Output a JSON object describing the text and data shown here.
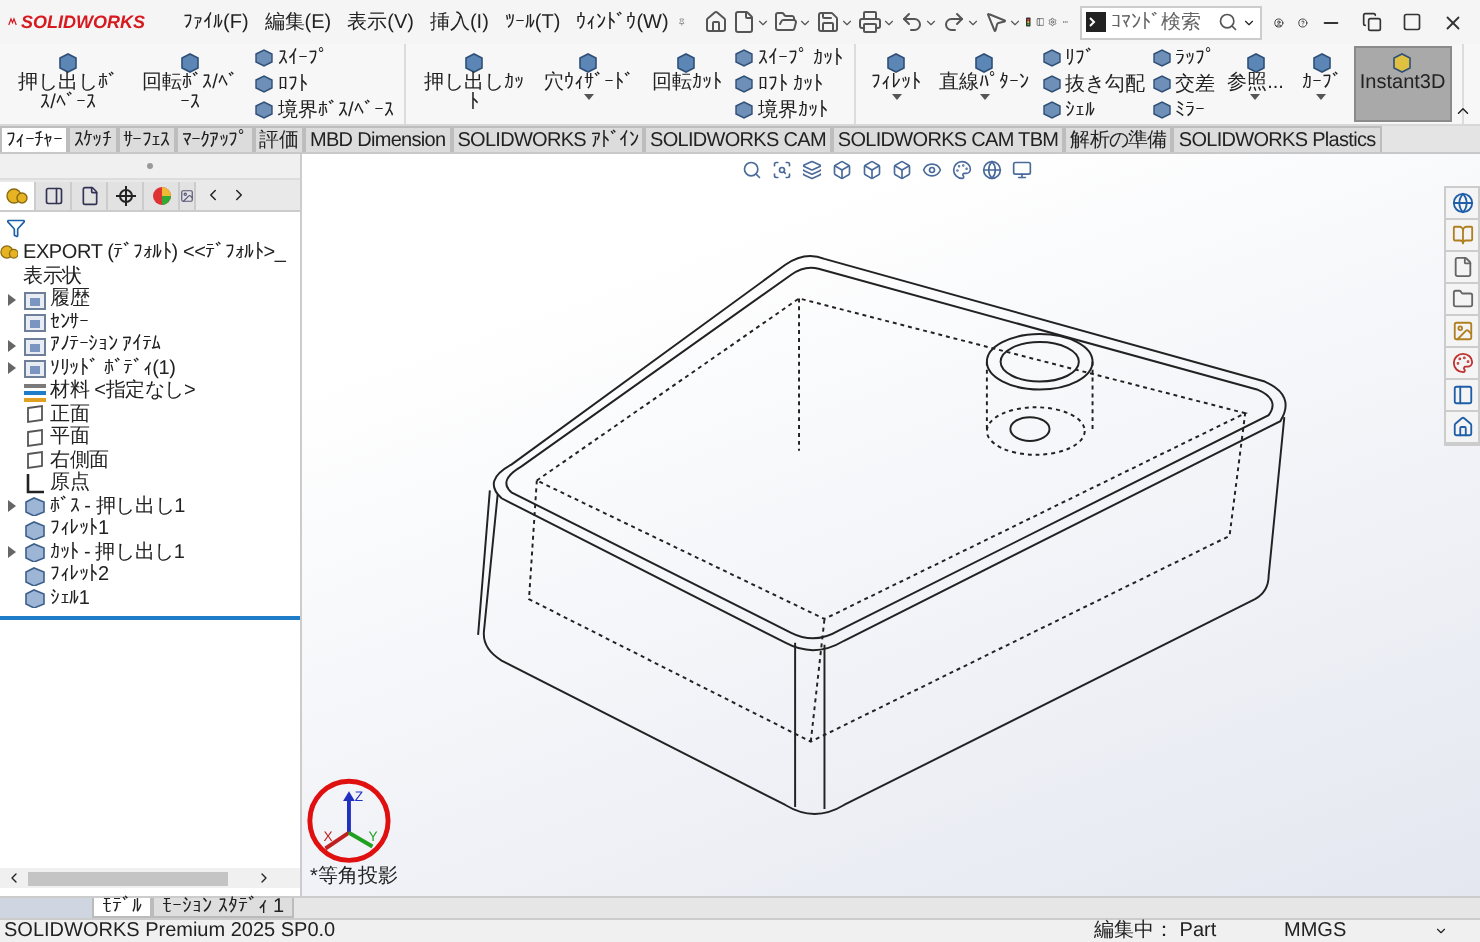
{
  "app": {
    "logo": "SOLIDWORKS"
  },
  "menus": [
    "ﾌｧｲﾙ(F)",
    "編集(E)",
    "表示(V)",
    "挿入(I)",
    "ﾂｰﾙ(T)",
    "ｳｨﾝﾄﾞｳ(W)"
  ],
  "search": {
    "placeholder": "ｺﾏﾝﾄﾞ検索"
  },
  "ribbon": {
    "groups": [
      {
        "columns": [
          {
            "kind": "large",
            "label": "押し出しﾎﾞｽ/ﾍﾞｰｽ",
            "dropdown": false,
            "on": false
          },
          {
            "kind": "large",
            "label": "回転ﾎﾞｽ/ﾍﾞｰｽ",
            "dropdown": false,
            "on": false
          },
          {
            "kind": "stack",
            "items": [
              "ｽｲｰﾌﾟ",
              "ﾛﾌﾄ",
              "境界ﾎﾞｽ/ﾍﾞｰｽ"
            ]
          }
        ]
      },
      {
        "columns": [
          {
            "kind": "large",
            "label": "押し出しｶｯﾄ",
            "dropdown": false,
            "on": false
          },
          {
            "kind": "large",
            "label": "穴ｳｨｻﾞｰﾄﾞ",
            "dropdown": true,
            "on": false
          },
          {
            "kind": "large",
            "label": "回転ｶｯﾄ",
            "dropdown": false,
            "on": false
          },
          {
            "kind": "stack",
            "items": [
              "ｽｲｰﾌﾟ ｶｯﾄ",
              "ﾛﾌﾄ ｶｯﾄ",
              "境界ｶｯﾄ"
            ]
          }
        ]
      },
      {
        "columns": [
          {
            "kind": "large",
            "label": "ﾌｨﾚｯﾄ",
            "dropdown": true,
            "on": false
          },
          {
            "kind": "large",
            "label": "直線ﾊﾟﾀｰﾝ",
            "dropdown": true,
            "on": false
          },
          {
            "kind": "stack",
            "items": [
              "ﾘﾌﾞ",
              "抜き勾配",
              "ｼｪﾙ"
            ]
          },
          {
            "kind": "stack",
            "items": [
              "ﾗｯﾌﾟ",
              "交差",
              "ﾐﾗｰ"
            ]
          },
          {
            "kind": "large",
            "label": "参照...",
            "dropdown": true,
            "on": false
          },
          {
            "kind": "large",
            "label": "ｶｰﾌﾞ",
            "dropdown": true,
            "on": false
          },
          {
            "kind": "large",
            "label": "Instant3D",
            "dropdown": false,
            "on": true
          }
        ]
      }
    ]
  },
  "feature_tabs": [
    {
      "label": "ﾌｨｰﾁｬｰ",
      "selected": true
    },
    {
      "label": "ｽｹｯﾁ",
      "selected": false
    },
    {
      "label": "ｻｰﾌｪｽ",
      "selected": false
    },
    {
      "label": "ﾏｰｸｱｯﾌﾟ",
      "selected": false
    },
    {
      "label": "評価",
      "selected": false
    },
    {
      "label": "MBD Dimension",
      "selected": false
    },
    {
      "label": "SOLIDWORKS ｱﾄﾞｲﾝ",
      "selected": false
    },
    {
      "label": "SOLIDWORKS CAM",
      "selected": false
    },
    {
      "label": "SOLIDWORKS CAM TBM",
      "selected": false
    },
    {
      "label": "解析の準備",
      "selected": false
    },
    {
      "label": "SOLIDWORKS Plastics",
      "selected": false
    }
  ],
  "tree": {
    "root": {
      "label": "EXPORT (ﾃﾞﾌｫﾙﾄ) <<ﾃﾞﾌｫﾙﾄ>_表示状",
      "children": [
        {
          "label": "履歴",
          "kind": "folder",
          "expandable": true
        },
        {
          "label": "ｾﾝｻｰ",
          "kind": "folder",
          "expandable": false
        },
        {
          "label": "ｱﾉﾃｰｼｮﾝ ｱｲﾃﾑ",
          "kind": "folder",
          "expandable": true
        },
        {
          "label": "ｿﾘｯﾄﾞ ﾎﾞﾃﾞｨ(1)",
          "kind": "folder",
          "expandable": true
        },
        {
          "label": "材料 <指定なし>",
          "kind": "material",
          "expandable": false
        },
        {
          "label": "正面",
          "kind": "plane",
          "expandable": false
        },
        {
          "label": "平面",
          "kind": "plane",
          "expandable": false
        },
        {
          "label": "右側面",
          "kind": "plane",
          "expandable": false
        },
        {
          "label": "原点",
          "kind": "origin",
          "expandable": false
        },
        {
          "label": "ﾎﾞｽ - 押し出し1",
          "kind": "feature",
          "expandable": true
        },
        {
          "label": "ﾌｨﾚｯﾄ1",
          "kind": "feature",
          "expandable": false
        },
        {
          "label": "ｶｯﾄ - 押し出し1",
          "kind": "feature",
          "expandable": true
        },
        {
          "label": "ﾌｨﾚｯﾄ2",
          "kind": "feature",
          "expandable": false
        },
        {
          "label": "ｼｪﾙ1",
          "kind": "feature",
          "expandable": false
        }
      ]
    }
  },
  "view": {
    "label": "*等角投影",
    "axes": [
      "Z",
      "X",
      "Y"
    ]
  },
  "bottom_tabs": [
    {
      "label": "ﾓﾃﾞﾙ",
      "selected": true
    },
    {
      "label": "ﾓｰｼｮﾝ ｽﾀﾃﾞｨ 1",
      "selected": false
    }
  ],
  "status_bar": {
    "product": "SOLIDWORKS Premium 2025 SP0.0",
    "mode": "編集中： Part",
    "units": "MMGS"
  }
}
